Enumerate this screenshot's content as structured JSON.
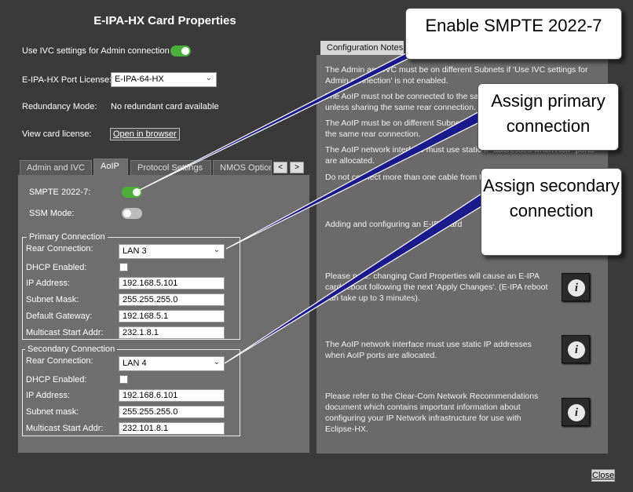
{
  "dialog": {
    "title": "E-IPA-HX Card Properties",
    "ivc_label": "Use IVC settings for Admin connection",
    "port_license_label": "E-IPA-HX Port License:",
    "port_license_value": "E-IPA-64-HX",
    "redundancy_label": "Redundancy Mode:",
    "redundancy_value": "No redundant card available",
    "view_license_label": "View card license:",
    "open_browser_label": "Open in browser",
    "close_label": "Close"
  },
  "tabs": [
    {
      "label": "Admin and IVC"
    },
    {
      "label": "AoIP"
    },
    {
      "label": "Protocol Settings"
    },
    {
      "label": "NMOS Options"
    }
  ],
  "tab_nav": {
    "prev": "<",
    "next": ">"
  },
  "aoip": {
    "smpte_label": "SMPTE 2022-7:",
    "smpte_on": true,
    "ssm_label": "SSM Mode:",
    "ssm_on": false
  },
  "primary": {
    "legend": "Primary Connection",
    "rear_label": "Rear Connection:",
    "rear_value": "LAN 3",
    "dhcp_label": "DHCP Enabled:",
    "ip_label": "IP Address:",
    "ip_value": "192.168.5.101",
    "subnet_label": "Subnet Mask:",
    "subnet_value": "255.255.255.0",
    "gateway_label": "Default Gateway:",
    "gateway_value": "192.168.5.1",
    "multicast_label": "Multicast Start Addr:",
    "multicast_value": "232.1.8.1"
  },
  "secondary": {
    "legend": "Secondary Connection",
    "rear_label": "Rear Connection:",
    "rear_value": "LAN 4",
    "dhcp_label": "DHCP Enabled:",
    "ip_label": "IP Address:",
    "ip_value": "192.168.6.101",
    "subnet_label": "Subnet mask:",
    "subnet_value": "255.255.255.0",
    "multicast_label": "Multicast Start Addr:",
    "multicast_value": "232.101.8.1"
  },
  "notes_panel": {
    "tab_label": "Configuration Notes",
    "notes": [
      "The Admin and IVC must be on different Subnets if 'Use IVC settings for Admin connection' is not enabled.",
      "The AoIP must not be connected to the same network as Admin or IVC, unless sharing the same rear connection.",
      "The AoIP must be on different Subnets to Admin or IVC, unless they share the same rear connection.",
      "The AoIP network interface must use static IP addresses when AoIP ports are allocated.",
      "Do not connect more than one cable from the card to the same network.",
      "Adding and configuring an E-IPA card"
    ],
    "info_notes": [
      "Please note: changing Card Properties will cause an E-IPA card reboot following the next 'Apply Changes'. (E-IPA reboot can take up to 3 minutes).",
      "The AoIP network interface must use static IP addresses when AoIP ports are allocated.",
      "Please refer to the Clear-Com Network Recommendations document which contains important information about configuring your IP Network infrastructure for use with Eclipse-HX."
    ]
  },
  "callouts": {
    "smpte": "Enable SMPTE 2022-7",
    "primary": "Assign primary connection",
    "secondary": "Assign secondary connection"
  },
  "icons": {
    "info": "info-icon",
    "chevron": "chevron-down-icon"
  },
  "colors": {
    "toggle_on": "#4caf3c",
    "toggle_off": "#bdbdbd",
    "background": "#3a3a3a",
    "panel": "#6e6e6e"
  }
}
